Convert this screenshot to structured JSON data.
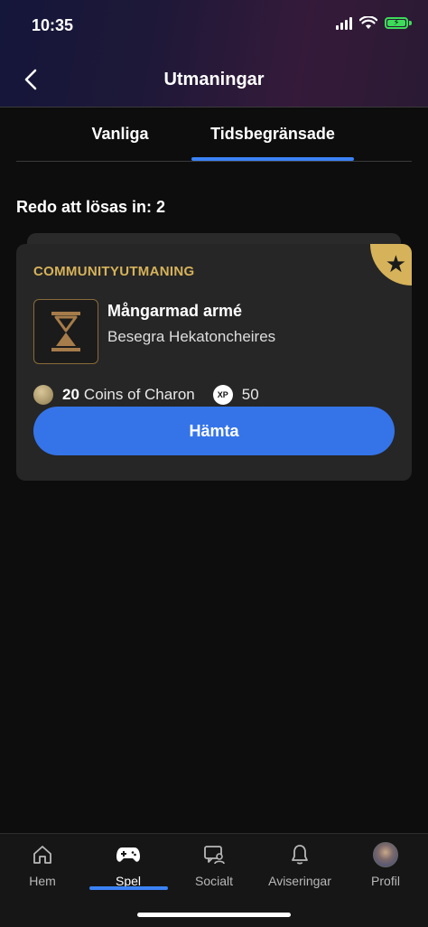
{
  "status_bar": {
    "time": "10:35"
  },
  "header": {
    "title": "Utmaningar"
  },
  "tabs": [
    {
      "label": "Vanliga"
    },
    {
      "label": "Tidsbegränsade"
    }
  ],
  "redeem": {
    "label": "Redo att lösas in: 2"
  },
  "challenge": {
    "category": "COMMUNITYUTMANING",
    "title": "Mångarmad armé",
    "subtitle": "Besegra Hekatoncheires",
    "reward_amount": "20",
    "reward_name": "Coins of Charon",
    "xp_badge": "XP",
    "xp_value": "50",
    "claim_label": "Hämta"
  },
  "bottom_nav": [
    {
      "label": "Hem",
      "icon": "home-icon"
    },
    {
      "label": "Spel",
      "icon": "gamepad-icon"
    },
    {
      "label": "Socialt",
      "icon": "social-icon"
    },
    {
      "label": "Aviseringar",
      "icon": "bell-icon"
    },
    {
      "label": "Profil",
      "icon": "avatar"
    }
  ],
  "colors": {
    "accent_blue": "#3b82f6",
    "button_blue": "#3574e8",
    "gold": "#d6b25a",
    "card_bg": "#262626",
    "page_bg": "#0d0d0d"
  }
}
